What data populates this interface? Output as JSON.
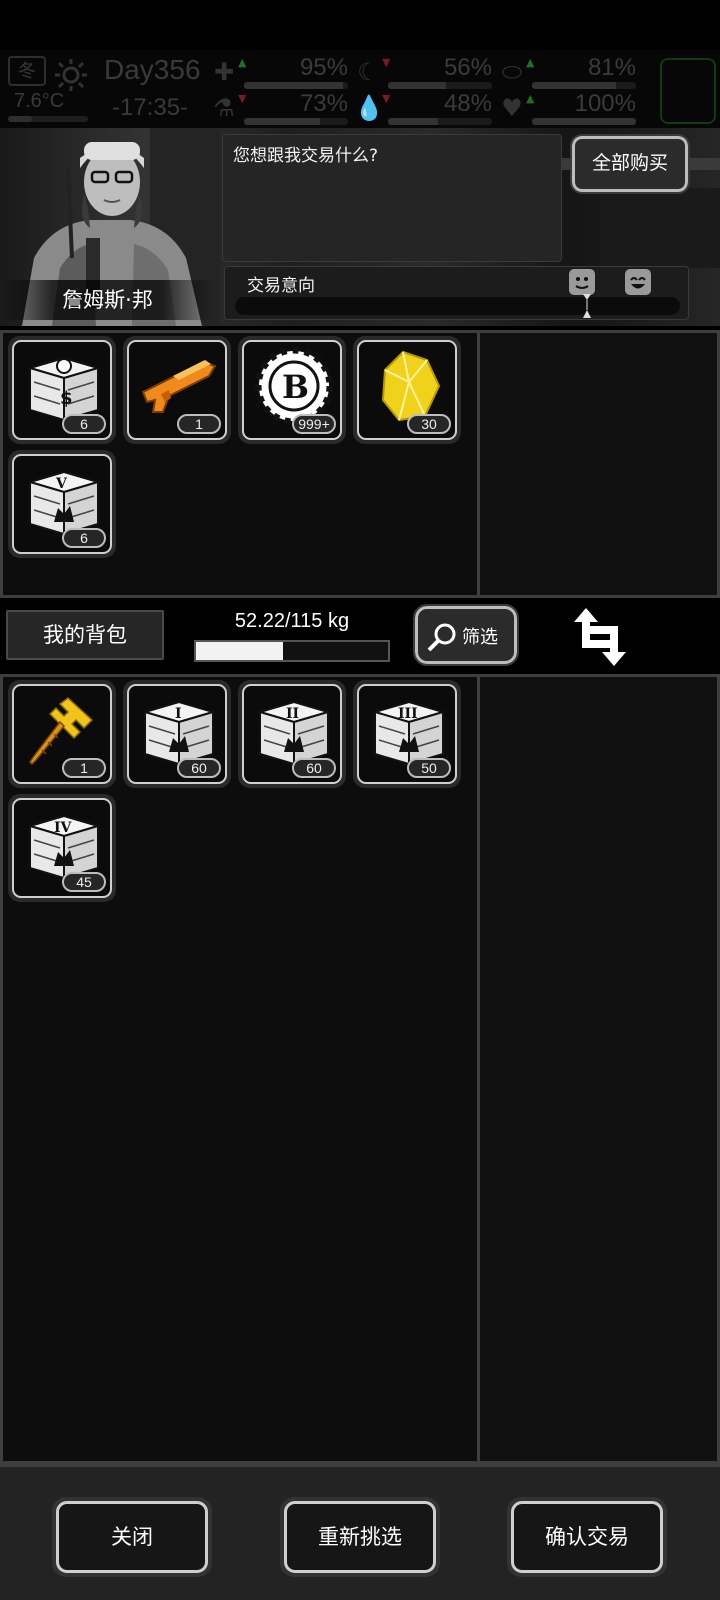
{
  "hud": {
    "season": "冬",
    "day": "Day356",
    "temperature": "7.6°C",
    "time": "-17:35-",
    "stats": [
      {
        "name": "health",
        "icon": "first-aid-kit-icon",
        "value": "95%",
        "level": 0.95,
        "trend": "up"
      },
      {
        "name": "hunger",
        "icon": "stomach-icon",
        "value": "56%",
        "level": 0.56,
        "trend": "down"
      },
      {
        "name": "medicine",
        "icon": "pill-icon",
        "value": "81%",
        "level": 0.81,
        "trend": "up"
      },
      {
        "name": "energy",
        "icon": "flask-icon",
        "value": "73%",
        "level": 0.73,
        "trend": "down"
      },
      {
        "name": "thirst",
        "icon": "water-drop-icon",
        "value": "48%",
        "level": 0.48,
        "trend": "down"
      },
      {
        "name": "mood",
        "icon": "heart-icon",
        "value": "100%",
        "level": 1.0,
        "trend": "up"
      }
    ]
  },
  "trader": {
    "name": "詹姆斯·邦",
    "dialog": "您想跟我交易什么?",
    "buy_all": "全部购买",
    "intent_label": "交易意向"
  },
  "trader_items": [
    {
      "name": "supply-crate-s",
      "icon": "crate-s-icon",
      "count": "6"
    },
    {
      "name": "orange-shotgun",
      "icon": "shotgun-icon",
      "count": "1"
    },
    {
      "name": "b-coin",
      "icon": "coin-b-icon",
      "count": "999+"
    },
    {
      "name": "gold-crystal",
      "icon": "crystal-icon",
      "count": "30"
    },
    {
      "name": "supply-crate-v",
      "icon": "crate-v-icon",
      "count": "6"
    }
  ],
  "bag": {
    "title": "我的背包",
    "weight": "52.22/115 kg",
    "weight_fraction": 0.454,
    "filter": "筛选"
  },
  "bag_items": [
    {
      "name": "golden-hammer",
      "icon": "hammer-icon",
      "count": "1"
    },
    {
      "name": "supply-crate-i",
      "icon": "crate-i-icon",
      "count": "60"
    },
    {
      "name": "supply-crate-ii",
      "icon": "crate-ii-icon",
      "count": "60"
    },
    {
      "name": "supply-crate-iii",
      "icon": "crate-iii-icon",
      "count": "50"
    },
    {
      "name": "supply-crate-iv",
      "icon": "crate-iv-icon",
      "count": "45"
    }
  ],
  "buttons": {
    "close": "关闭",
    "reselect": "重新挑选",
    "confirm": "确认交易"
  },
  "colors": {
    "background": "#000000",
    "panel": "#0d0d0d",
    "gold": "#f0c419",
    "orange": "#f08a1c"
  }
}
